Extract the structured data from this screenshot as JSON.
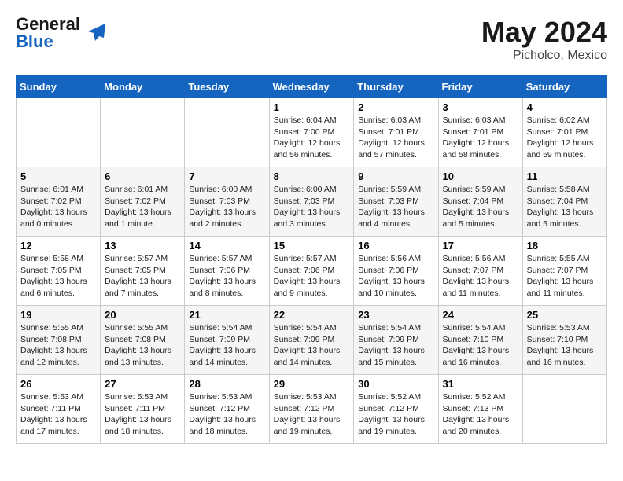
{
  "header": {
    "logo_general": "General",
    "logo_blue": "Blue",
    "month_title": "May 2024",
    "location": "Picholco, Mexico"
  },
  "days_of_week": [
    "Sunday",
    "Monday",
    "Tuesday",
    "Wednesday",
    "Thursday",
    "Friday",
    "Saturday"
  ],
  "weeks": [
    [
      {
        "day": "",
        "info": ""
      },
      {
        "day": "",
        "info": ""
      },
      {
        "day": "",
        "info": ""
      },
      {
        "day": "1",
        "info": "Sunrise: 6:04 AM\nSunset: 7:00 PM\nDaylight: 12 hours\nand 56 minutes."
      },
      {
        "day": "2",
        "info": "Sunrise: 6:03 AM\nSunset: 7:01 PM\nDaylight: 12 hours\nand 57 minutes."
      },
      {
        "day": "3",
        "info": "Sunrise: 6:03 AM\nSunset: 7:01 PM\nDaylight: 12 hours\nand 58 minutes."
      },
      {
        "day": "4",
        "info": "Sunrise: 6:02 AM\nSunset: 7:01 PM\nDaylight: 12 hours\nand 59 minutes."
      }
    ],
    [
      {
        "day": "5",
        "info": "Sunrise: 6:01 AM\nSunset: 7:02 PM\nDaylight: 13 hours\nand 0 minutes."
      },
      {
        "day": "6",
        "info": "Sunrise: 6:01 AM\nSunset: 7:02 PM\nDaylight: 13 hours\nand 1 minute."
      },
      {
        "day": "7",
        "info": "Sunrise: 6:00 AM\nSunset: 7:03 PM\nDaylight: 13 hours\nand 2 minutes."
      },
      {
        "day": "8",
        "info": "Sunrise: 6:00 AM\nSunset: 7:03 PM\nDaylight: 13 hours\nand 3 minutes."
      },
      {
        "day": "9",
        "info": "Sunrise: 5:59 AM\nSunset: 7:03 PM\nDaylight: 13 hours\nand 4 minutes."
      },
      {
        "day": "10",
        "info": "Sunrise: 5:59 AM\nSunset: 7:04 PM\nDaylight: 13 hours\nand 5 minutes."
      },
      {
        "day": "11",
        "info": "Sunrise: 5:58 AM\nSunset: 7:04 PM\nDaylight: 13 hours\nand 5 minutes."
      }
    ],
    [
      {
        "day": "12",
        "info": "Sunrise: 5:58 AM\nSunset: 7:05 PM\nDaylight: 13 hours\nand 6 minutes."
      },
      {
        "day": "13",
        "info": "Sunrise: 5:57 AM\nSunset: 7:05 PM\nDaylight: 13 hours\nand 7 minutes."
      },
      {
        "day": "14",
        "info": "Sunrise: 5:57 AM\nSunset: 7:06 PM\nDaylight: 13 hours\nand 8 minutes."
      },
      {
        "day": "15",
        "info": "Sunrise: 5:57 AM\nSunset: 7:06 PM\nDaylight: 13 hours\nand 9 minutes."
      },
      {
        "day": "16",
        "info": "Sunrise: 5:56 AM\nSunset: 7:06 PM\nDaylight: 13 hours\nand 10 minutes."
      },
      {
        "day": "17",
        "info": "Sunrise: 5:56 AM\nSunset: 7:07 PM\nDaylight: 13 hours\nand 11 minutes."
      },
      {
        "day": "18",
        "info": "Sunrise: 5:55 AM\nSunset: 7:07 PM\nDaylight: 13 hours\nand 11 minutes."
      }
    ],
    [
      {
        "day": "19",
        "info": "Sunrise: 5:55 AM\nSunset: 7:08 PM\nDaylight: 13 hours\nand 12 minutes."
      },
      {
        "day": "20",
        "info": "Sunrise: 5:55 AM\nSunset: 7:08 PM\nDaylight: 13 hours\nand 13 minutes."
      },
      {
        "day": "21",
        "info": "Sunrise: 5:54 AM\nSunset: 7:09 PM\nDaylight: 13 hours\nand 14 minutes."
      },
      {
        "day": "22",
        "info": "Sunrise: 5:54 AM\nSunset: 7:09 PM\nDaylight: 13 hours\nand 14 minutes."
      },
      {
        "day": "23",
        "info": "Sunrise: 5:54 AM\nSunset: 7:09 PM\nDaylight: 13 hours\nand 15 minutes."
      },
      {
        "day": "24",
        "info": "Sunrise: 5:54 AM\nSunset: 7:10 PM\nDaylight: 13 hours\nand 16 minutes."
      },
      {
        "day": "25",
        "info": "Sunrise: 5:53 AM\nSunset: 7:10 PM\nDaylight: 13 hours\nand 16 minutes."
      }
    ],
    [
      {
        "day": "26",
        "info": "Sunrise: 5:53 AM\nSunset: 7:11 PM\nDaylight: 13 hours\nand 17 minutes."
      },
      {
        "day": "27",
        "info": "Sunrise: 5:53 AM\nSunset: 7:11 PM\nDaylight: 13 hours\nand 18 minutes."
      },
      {
        "day": "28",
        "info": "Sunrise: 5:53 AM\nSunset: 7:12 PM\nDaylight: 13 hours\nand 18 minutes."
      },
      {
        "day": "29",
        "info": "Sunrise: 5:53 AM\nSunset: 7:12 PM\nDaylight: 13 hours\nand 19 minutes."
      },
      {
        "day": "30",
        "info": "Sunrise: 5:52 AM\nSunset: 7:12 PM\nDaylight: 13 hours\nand 19 minutes."
      },
      {
        "day": "31",
        "info": "Sunrise: 5:52 AM\nSunset: 7:13 PM\nDaylight: 13 hours\nand 20 minutes."
      },
      {
        "day": "",
        "info": ""
      }
    ]
  ]
}
